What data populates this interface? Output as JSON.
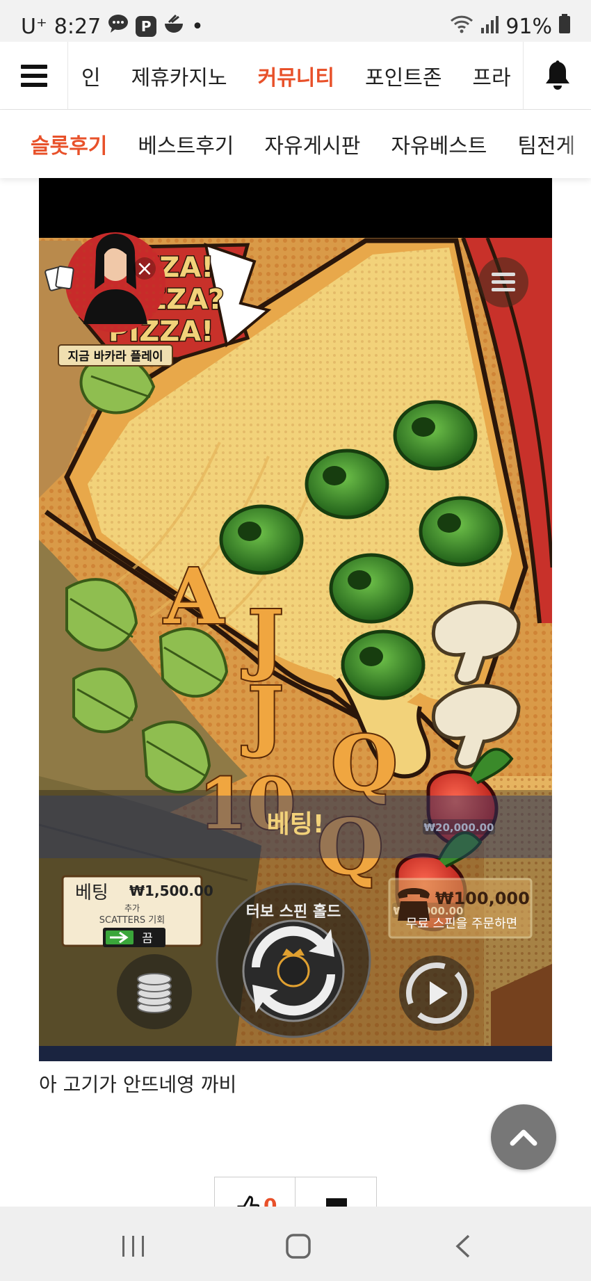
{
  "status_bar": {
    "carrier": "U⁺",
    "time": "8:27",
    "notif_p": "P",
    "dot": "•",
    "battery": "91%"
  },
  "top_nav": {
    "items": [
      "인",
      "제휴카지노",
      "커뮤니티",
      "포인트존",
      "프라"
    ],
    "active_index": 2
  },
  "sub_nav": {
    "items": [
      "슬롯후기",
      "베스트후기",
      "자유게시판",
      "자유베스트",
      "팀전게"
    ],
    "active_index": 0
  },
  "game": {
    "logo_lines": [
      "PIZZA!",
      "PIZZA?",
      "PIZZA!"
    ],
    "promo_label": "지금 바카라 플레이",
    "promo_close": "×",
    "bet_banner": "베팅!",
    "bet_panel": {
      "label": "베팅",
      "amount": "₩1,500.00",
      "extra_line1": "추가",
      "extra_line2": "SCATTERS 기회",
      "toggle_label": "끔"
    },
    "turbo_label": "터보 스핀 홀드",
    "free_spin": {
      "amount": "₩100,000",
      "label": "무료 스핀을 주문하면"
    },
    "reels": [
      [
        "basil",
        "basil"
      ],
      [
        "A",
        "basil",
        "basil"
      ],
      [
        "olive",
        "J",
        "J",
        "10"
      ],
      [
        "olive",
        "olive",
        "olive",
        "Q",
        "Q"
      ],
      [
        "olive",
        "olive",
        "mushroom",
        "mushroom",
        "pepper",
        "pepper"
      ]
    ],
    "pepper_value": "₩20,000.00",
    "colors": {
      "pizza": "#f2d27a",
      "crust": "#e8a84a",
      "sauce": "#c8312a",
      "olive": "#3b8a2a",
      "letter": "#f0a640",
      "basil": "#8fbe50"
    }
  },
  "post": {
    "caption": "아 고기가 안뜨네영 까비",
    "likes": "0"
  },
  "colors": {
    "accent": "#e8512a"
  },
  "icons": [
    "hamburger-menu-icon",
    "bell-icon",
    "chevron-up-icon",
    "thumbs-up-icon",
    "recent-apps-icon",
    "home-icon",
    "back-icon"
  ]
}
